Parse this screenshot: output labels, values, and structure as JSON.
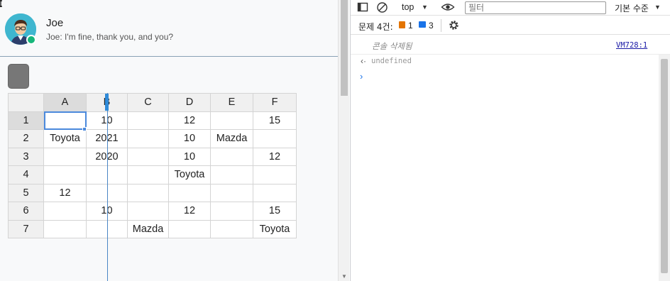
{
  "chat": {
    "user_name": "Joe",
    "last_message": "Joe: I'm fine, thank you, and you?"
  },
  "sheet": {
    "columns": [
      "A",
      "B",
      "C",
      "D",
      "E",
      "F"
    ],
    "rows": [
      {
        "num": "1",
        "cells": [
          "",
          "10",
          "",
          "12",
          "",
          "15"
        ]
      },
      {
        "num": "2",
        "cells": [
          "Toyota",
          "2021",
          "",
          "10",
          "Mazda",
          ""
        ]
      },
      {
        "num": "3",
        "cells": [
          "",
          "2020",
          "",
          "10",
          "",
          "12"
        ]
      },
      {
        "num": "4",
        "cells": [
          "",
          "",
          "",
          "Toyota",
          "",
          ""
        ]
      },
      {
        "num": "5",
        "cells": [
          "12",
          "",
          "",
          "",
          "",
          ""
        ]
      },
      {
        "num": "6",
        "cells": [
          "",
          "10",
          "",
          "12",
          "",
          "15"
        ]
      },
      {
        "num": "7",
        "cells": [
          "",
          "",
          "Mazda",
          "",
          "",
          "Toyota"
        ]
      }
    ]
  },
  "devtools": {
    "context": "top",
    "filter_placeholder": "필터",
    "level": "기본 수준",
    "issues_label": "문제 4건:",
    "warn_count": "1",
    "info_count": "3",
    "console_cleared": "콘솔 삭제됨",
    "source_link": "VM728:1",
    "result_value": "undefined"
  },
  "colors": {
    "accent": "#4b89dc",
    "status_online": "#16b67a",
    "warn": "#e37400",
    "info": "#1a73e8"
  }
}
